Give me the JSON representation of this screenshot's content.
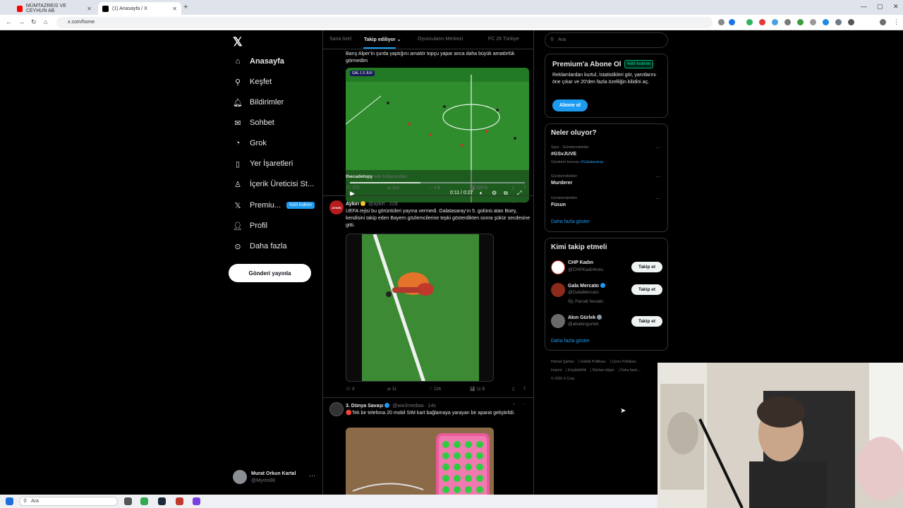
{
  "browser": {
    "tabs": [
      {
        "title": "MÜMTAZREIS VE CEYHUN AB",
        "active": false
      },
      {
        "title": "(1) Anasayfa / X",
        "active": true
      }
    ],
    "url": "x.com/home"
  },
  "sidebar": {
    "items": [
      {
        "label": "Anasayfa",
        "icon": "home-icon",
        "active": true
      },
      {
        "label": "Keşfet",
        "icon": "search-icon"
      },
      {
        "label": "Bildirimler",
        "icon": "bell-icon"
      },
      {
        "label": "Sohbet",
        "icon": "mail-icon"
      },
      {
        "label": "Grok",
        "icon": "grok-icon"
      },
      {
        "label": "Yer İşaretleri",
        "icon": "bookmark-icon"
      },
      {
        "label": "İçerik Üreticisi St...",
        "icon": "creator-icon"
      },
      {
        "label": "Premiu...",
        "icon": "x-icon",
        "badge": "%50 İndirim"
      },
      {
        "label": "Profil",
        "icon": "profile-icon"
      },
      {
        "label": "Daha fazla",
        "icon": "more-circle-icon"
      }
    ],
    "post_button": "Gönderi yayınla",
    "account": {
      "name": "Murat Orkun Kartal",
      "handle": "@Myres88"
    }
  },
  "feed": {
    "tabs": [
      "Sana özel",
      "Takip ediliyor",
      "Oyuncuların Merkezi",
      "FC 26 Türkiye"
    ],
    "tweet1": {
      "text": "Barış Alper'in şurda yaptığını amatör topçu yapar anca daha büyük amatörlük görmedim",
      "video_time": "0:11 / 0:27",
      "scoreboard": "GAL 1 0 JUV",
      "attribution": "thecadetopy",
      "attribution_suffix": "adlı kullanıcıdan",
      "replies": "273",
      "reposts": "214",
      "likes": "4 B",
      "views": "929 B"
    },
    "tweet2": {
      "name": "Aykırı",
      "handle": "@aykiri · 22d",
      "avatar_text": "AYKIRI",
      "text": "UEFA rejisi bu görüntüleri yayına vermedi. Galatasaray'ın 5. golünü atan Boey, kendisini takip eden Bayern gözlemcilerine tepki gösterdikten sonra şükür secdesine gitti.",
      "replies": "9",
      "reposts": "11",
      "likes": "226",
      "views": "11 B"
    },
    "tweet3": {
      "name": "3. Dünya Savaşı",
      "handle": "@ww3mediaa · 14s",
      "text": "🔴Tek bir telefona 20 mobil SIM kart bağlamaya yarayan bir aparat geliştirildi."
    }
  },
  "right": {
    "search_placeholder": "Ara",
    "premium": {
      "title": "Premium'a Abone Ol",
      "badge": "%50 İndirim",
      "text": "Reklamlardan kurtul, İstatistikleri gör, yanıtlarını öne çıkar ve 20'den fazla özelliğin kilidini aç.",
      "button": "Abone ol"
    },
    "trends": {
      "title": "Neler oluyor?",
      "items": [
        {
          "meta": "Spor · Gündemdekiler",
          "name": "#GSvJUVE",
          "extra": "Gündem konusu",
          "extra_link": "#Galatasaray"
        },
        {
          "meta": "Gündemdekiler",
          "name": "Murderer"
        },
        {
          "meta": "Gündemdekiler",
          "name": "Füsun"
        }
      ],
      "show_more": "Daha fazla göster"
    },
    "who_to_follow": {
      "title": "Kimi takip etmeli",
      "items": [
        {
          "name": "CHP Kadın",
          "handle": "@CHPKadinKolu",
          "button": "Takip et"
        },
        {
          "name": "Gala Mercato",
          "handle": "@GalaMercato",
          "note": "Parodi hesabı",
          "button": "Takip et"
        },
        {
          "name": "Akın Gürlek",
          "handle": "@abakingurlek",
          "button": "Takip et"
        }
      ],
      "show_more": "Daha fazla göster"
    },
    "footer": [
      "Hizmet Şartları",
      "Gizlilik Politikası",
      "Çerez Politikası",
      "Imprint",
      "Erişilebilirlik",
      "Reklam bilgisi",
      "Daha fazla ...",
      "© 2026 X Corp."
    ]
  },
  "taskbar": {
    "search": "Ara"
  },
  "colors": {
    "accent": "#1d9bf0",
    "background": "#000000",
    "border": "#2f3336",
    "muted": "#71767b"
  }
}
